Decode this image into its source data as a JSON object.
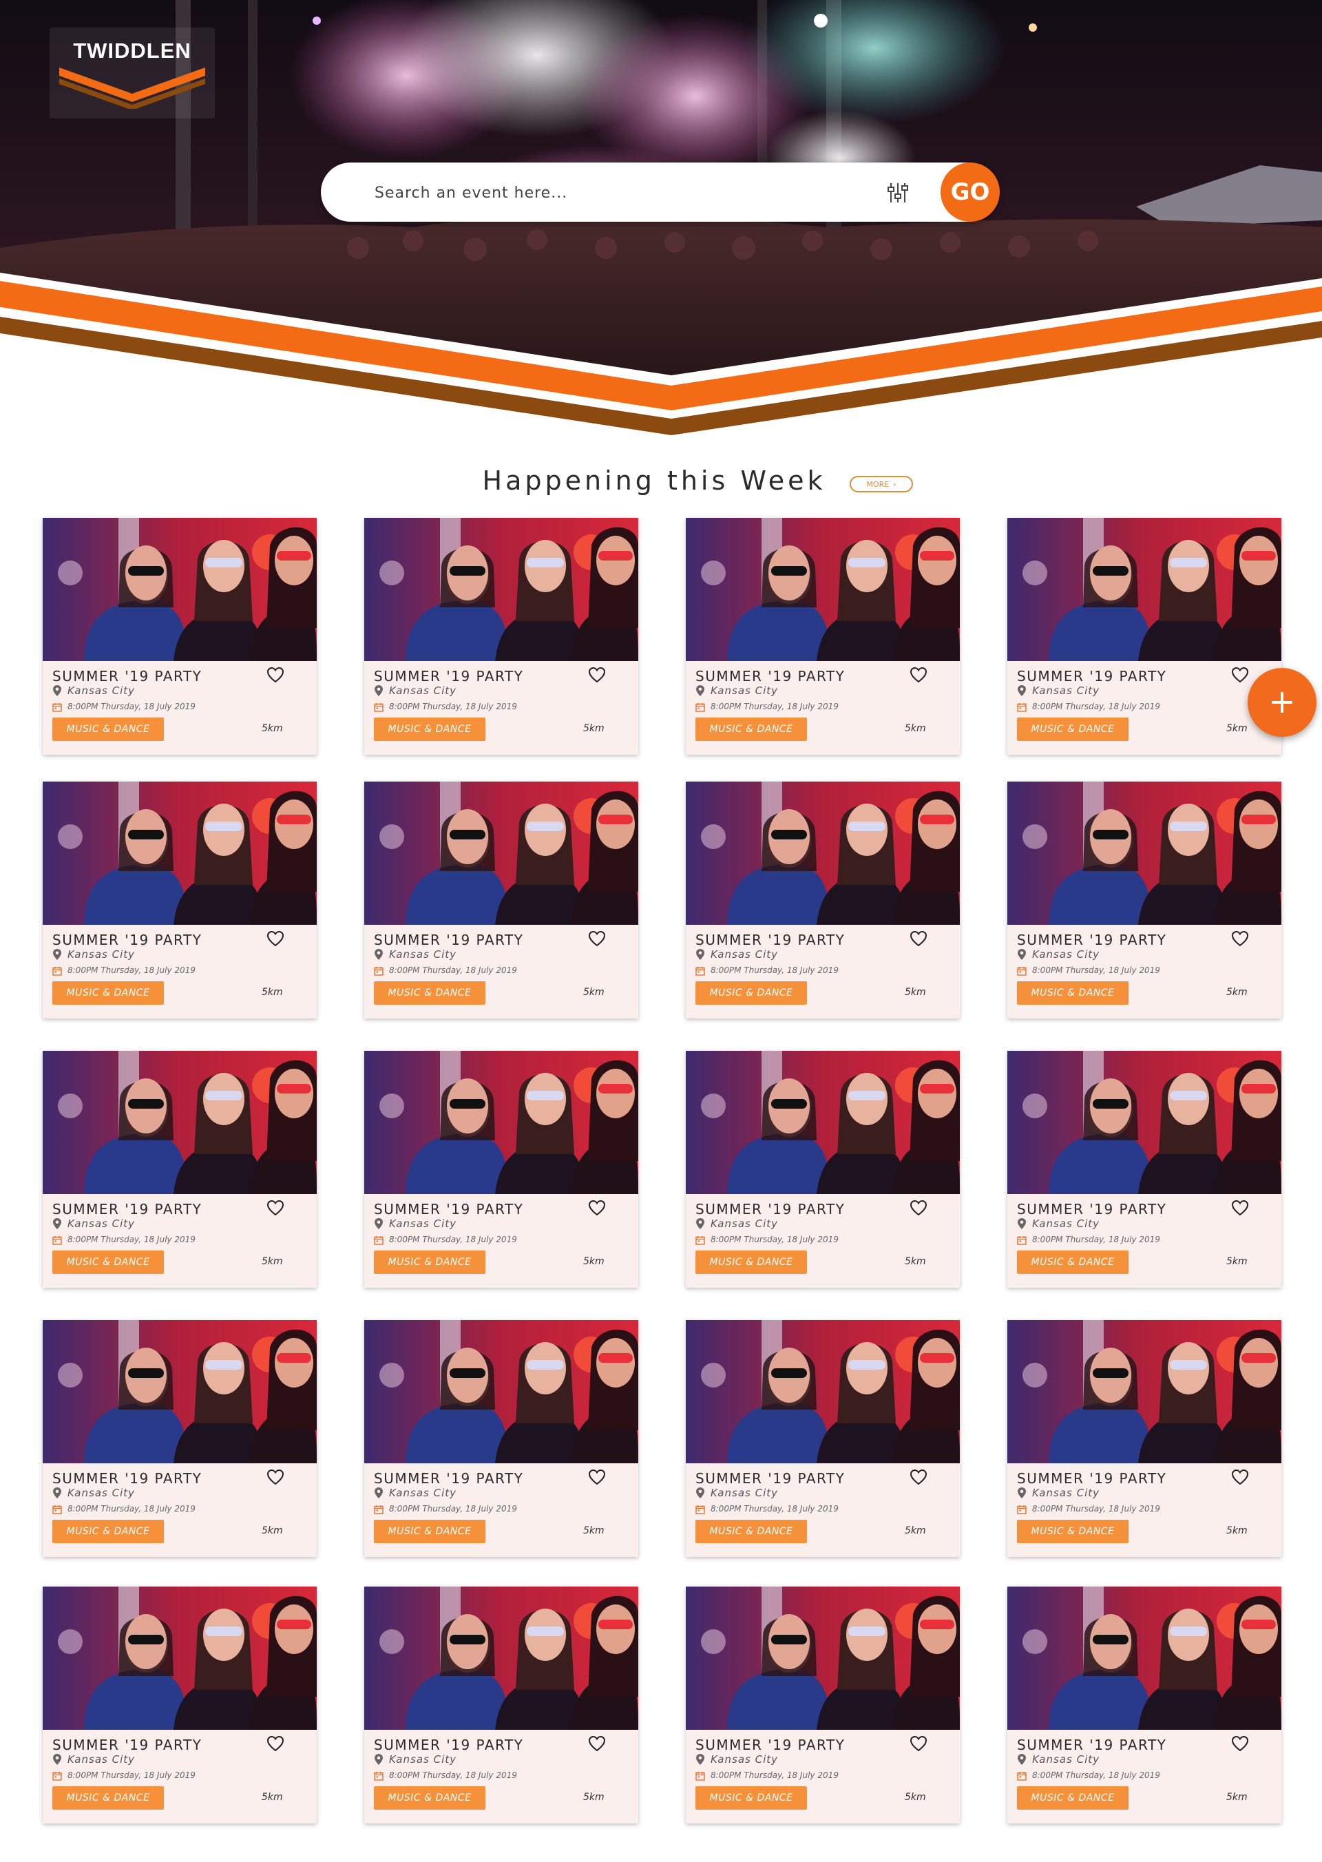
{
  "brand": {
    "name": "TWIDDLEN"
  },
  "search": {
    "placeholder": "Search an event here...",
    "go_label": "GO"
  },
  "section": {
    "title": "Happening this Week",
    "more_label": "MORE"
  },
  "colors": {
    "accent": "#f36b15",
    "tag": "#f5913a",
    "brown": "#8b4a10",
    "card_bg": "#fbefee"
  },
  "events": [
    {
      "title": "SUMMER '19 PARTY",
      "city": "Kansas City",
      "datetime": "8:00PM Thursday, 18 July 2019",
      "tag": "MUSIC & DANCE",
      "distance": "5km"
    },
    {
      "title": "SUMMER '19 PARTY",
      "city": "Kansas City",
      "datetime": "8:00PM Thursday, 18 July 2019",
      "tag": "MUSIC & DANCE",
      "distance": "5km"
    },
    {
      "title": "SUMMER '19 PARTY",
      "city": "Kansas City",
      "datetime": "8:00PM Thursday, 18 July 2019",
      "tag": "MUSIC & DANCE",
      "distance": "5km"
    },
    {
      "title": "SUMMER '19 PARTY",
      "city": "Kansas City",
      "datetime": "8:00PM Thursday, 18 July 2019",
      "tag": "MUSIC & DANCE",
      "distance": "5km"
    },
    {
      "title": "SUMMER '19 PARTY",
      "city": "Kansas City",
      "datetime": "8:00PM Thursday, 18 July 2019",
      "tag": "MUSIC & DANCE",
      "distance": "5km"
    },
    {
      "title": "SUMMER '19 PARTY",
      "city": "Kansas City",
      "datetime": "8:00PM Thursday, 18 July 2019",
      "tag": "MUSIC & DANCE",
      "distance": "5km"
    },
    {
      "title": "SUMMER '19 PARTY",
      "city": "Kansas City",
      "datetime": "8:00PM Thursday, 18 July 2019",
      "tag": "MUSIC & DANCE",
      "distance": "5km"
    },
    {
      "title": "SUMMER '19 PARTY",
      "city": "Kansas City",
      "datetime": "8:00PM Thursday, 18 July 2019",
      "tag": "MUSIC & DANCE",
      "distance": "5km"
    },
    {
      "title": "SUMMER '19 PARTY",
      "city": "Kansas City",
      "datetime": "8:00PM Thursday, 18 July 2019",
      "tag": "MUSIC & DANCE",
      "distance": "5km"
    },
    {
      "title": "SUMMER '19 PARTY",
      "city": "Kansas City",
      "datetime": "8:00PM Thursday, 18 July 2019",
      "tag": "MUSIC & DANCE",
      "distance": "5km"
    },
    {
      "title": "SUMMER '19 PARTY",
      "city": "Kansas City",
      "datetime": "8:00PM Thursday, 18 July 2019",
      "tag": "MUSIC & DANCE",
      "distance": "5km"
    },
    {
      "title": "SUMMER '19 PARTY",
      "city": "Kansas City",
      "datetime": "8:00PM Thursday, 18 July 2019",
      "tag": "MUSIC & DANCE",
      "distance": "5km"
    },
    {
      "title": "SUMMER '19 PARTY",
      "city": "Kansas City",
      "datetime": "8:00PM Thursday, 18 July 2019",
      "tag": "MUSIC & DANCE",
      "distance": "5km"
    },
    {
      "title": "SUMMER '19 PARTY",
      "city": "Kansas City",
      "datetime": "8:00PM Thursday, 18 July 2019",
      "tag": "MUSIC & DANCE",
      "distance": "5km"
    },
    {
      "title": "SUMMER '19 PARTY",
      "city": "Kansas City",
      "datetime": "8:00PM Thursday, 18 July 2019",
      "tag": "MUSIC & DANCE",
      "distance": "5km"
    },
    {
      "title": "SUMMER '19 PARTY",
      "city": "Kansas City",
      "datetime": "8:00PM Thursday, 18 July 2019",
      "tag": "MUSIC & DANCE",
      "distance": "5km"
    },
    {
      "title": "SUMMER '19 PARTY",
      "city": "Kansas City",
      "datetime": "8:00PM Thursday, 18 July 2019",
      "tag": "MUSIC & DANCE",
      "distance": "5km"
    },
    {
      "title": "SUMMER '19 PARTY",
      "city": "Kansas City",
      "datetime": "8:00PM Thursday, 18 July 2019",
      "tag": "MUSIC & DANCE",
      "distance": "5km"
    },
    {
      "title": "SUMMER '19 PARTY",
      "city": "Kansas City",
      "datetime": "8:00PM Thursday, 18 July 2019",
      "tag": "MUSIC & DANCE",
      "distance": "5km"
    },
    {
      "title": "SUMMER '19 PARTY",
      "city": "Kansas City",
      "datetime": "8:00PM Thursday, 18 July 2019",
      "tag": "MUSIC & DANCE",
      "distance": "5km"
    }
  ],
  "icons": {
    "favorite": "heart-icon",
    "location": "location-pin-icon",
    "date": "calendar-icon",
    "filter": "filter-sliders-icon",
    "add": "plus-icon"
  }
}
